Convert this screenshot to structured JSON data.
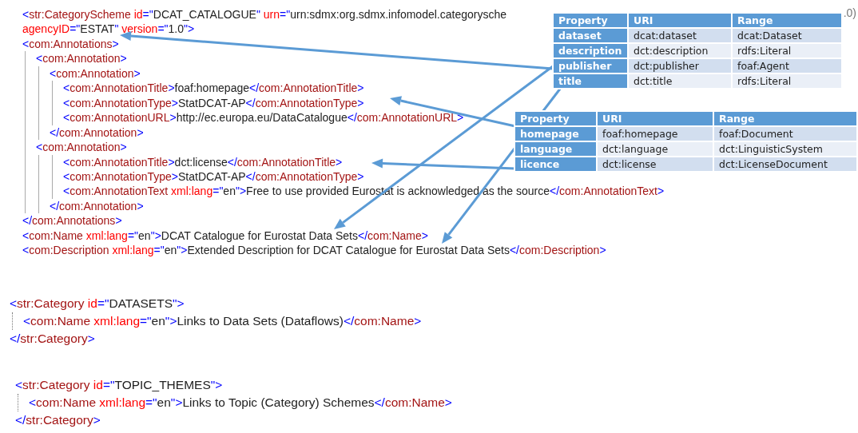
{
  "code_blocks": [
    {
      "lines": [
        {
          "line": "<str:CategoryScheme id=\"DCAT_CATALOGUE\" urn=\"urn:sdmx:org.sdmx.infomodel.categorysche"
        },
        {
          "line": "agencyID=\"ESTAT\" version=\"1.0\">",
          "continues_tag": true
        },
        {
          "open": "<com:Annotations>",
          "children": [
            {
              "open": "<com:Annotation>",
              "children": [
                {
                  "open": "<com:Annotation>",
                  "children": [
                    {
                      "line": "<com:AnnotationTitle>foaf:homepage</com:AnnotationTitle>"
                    },
                    {
                      "line": "<com:AnnotationType>StatDCAT-AP</com:AnnotationType>"
                    },
                    {
                      "line": "<com:AnnotationURL>http://ec.europa.eu/DataCatalogue</com:AnnotationURL>"
                    }
                  ],
                  "close": "</com:Annotation>"
                }
              ]
            },
            {
              "open": "<com:Annotation>",
              "children": [
                {
                  "children": [
                    {
                      "line": "<com:AnnotationTitle>dct:license</com:AnnotationTitle>"
                    },
                    {
                      "line": "<com:AnnotationType>StatDCAT-AP</com:AnnotationType>"
                    },
                    {
                      "line": "<com:AnnotationText xml:lang=\"en\">Free to use provided Eurostat is acknowledged as the source</com:AnnotationText>"
                    }
                  ],
                  "close": "</com:Annotation>"
                }
              ]
            }
          ],
          "close": "</com:Annotations>"
        },
        {
          "line": "<com:Name xml:lang=\"en\">DCAT Catalogue for Eurostat Data Sets</com:Name>"
        },
        {
          "line": "<com:Description xml:lang=\"en\">Extended Description for DCAT Catalogue for Eurostat Data Sets</com:Description>"
        }
      ]
    },
    {
      "lines": [
        {
          "open": "<str:Category id=\"DATASETS\">",
          "children": [
            {
              "line": "<com:Name xml:lang=\"en\">Links to Data Sets (Dataflows)</com:Name>"
            }
          ],
          "close": "</str:Category>"
        }
      ]
    },
    {
      "lines": [
        {
          "open": "<str:Category id=\"TOPIC_THEMES\">",
          "children": [
            {
              "line": "<com:Name xml:lang=\"en\">Links to Topic (Category) Schemes</com:Name>"
            }
          ],
          "close": "</str:Category>"
        }
      ]
    }
  ],
  "line_tail": ".0)",
  "tables": [
    {
      "columns": [
        "Property",
        "URI",
        "Range"
      ],
      "rows": [
        [
          "dataset",
          "dcat:dataset",
          "dcat:Dataset"
        ],
        [
          "description",
          "dct:description",
          "rdfs:Literal"
        ],
        [
          "publisher",
          "dct:publisher",
          "foaf:Agent"
        ],
        [
          "title",
          "dct:title",
          "rdfs:Literal"
        ]
      ]
    },
    {
      "columns": [
        "Property",
        "URI",
        "Range"
      ],
      "rows": [
        [
          "homepage",
          "foaf:homepage",
          "foaf:Document"
        ],
        [
          "language",
          "dct:language",
          "dct:LinguisticSystem"
        ],
        [
          "licence",
          "dct:license",
          "dct:LicenseDocument"
        ]
      ]
    }
  ]
}
